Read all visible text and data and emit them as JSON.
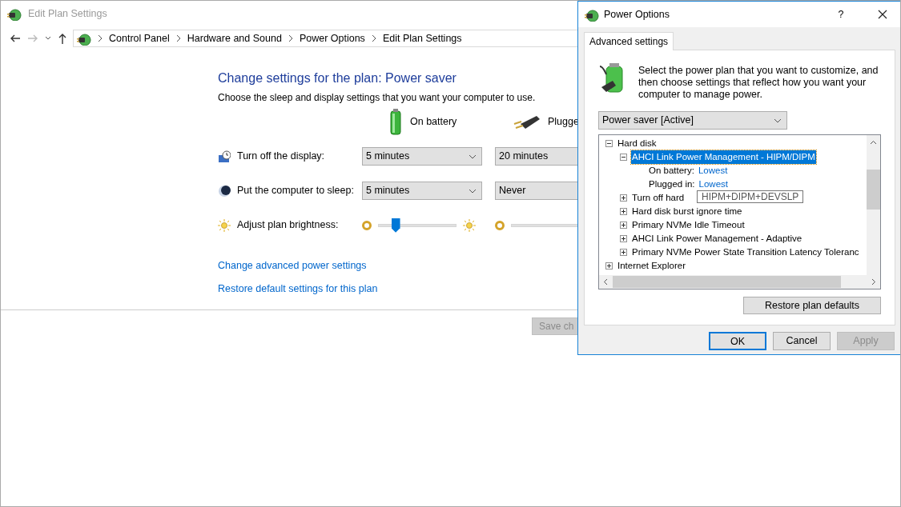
{
  "main_window": {
    "title": "Edit Plan Settings",
    "breadcrumb": [
      "Control Panel",
      "Hardware and Sound",
      "Power Options",
      "Edit Plan Settings"
    ],
    "heading": "Change settings for the plan: Power saver",
    "subheading": "Choose the sleep and display settings that you want your computer to use.",
    "columns": [
      {
        "label": "On battery",
        "kind": "battery"
      },
      {
        "label": "Plugge",
        "kind": "plug"
      }
    ],
    "settings": [
      {
        "label": "Turn off the display:",
        "kind": "display",
        "values": [
          "5 minutes",
          "20 minutes"
        ]
      },
      {
        "label": "Put the computer to sleep:",
        "kind": "sleep",
        "values": [
          "5 minutes",
          "Never"
        ]
      }
    ],
    "brightness": {
      "label": "Adjust plan brightness:",
      "level": 0.22
    },
    "links": [
      "Change advanced power settings",
      "Restore default settings for this plan"
    ],
    "save_button": {
      "label": "Save ch",
      "disabled": true
    }
  },
  "dialog": {
    "title": "Power Options",
    "help": "?",
    "tabs": [
      {
        "label": "Advanced settings",
        "selected": true
      }
    ],
    "intro": "Select the power plan that you want to customize, and then choose settings that reflect how you want your computer to manage power.",
    "plan": "Power saver [Active]",
    "tree": [
      {
        "label": "Hard disk",
        "expanded": true,
        "selected": false,
        "children": [
          {
            "label": "AHCI Link Power Management - HIPM/DIPM",
            "expanded": true,
            "selected": true,
            "settings": [
              {
                "label": "On battery:",
                "value": "Lowest"
              },
              {
                "label": "Plugged in:",
                "value": "Lowest"
              }
            ]
          },
          {
            "label": "Turn off hard",
            "expanded": false,
            "selected": false
          },
          {
            "label": "Hard disk burst ignore time",
            "expanded": false,
            "selected": false
          },
          {
            "label": "Primary NVMe Idle Timeout",
            "expanded": false,
            "selected": false
          },
          {
            "label": "AHCI Link Power Management - Adaptive",
            "expanded": false,
            "selected": false
          },
          {
            "label": "Primary NVMe Power State Transition Latency Toleranc",
            "expanded": false,
            "selected": false
          }
        ]
      },
      {
        "label": "Internet Explorer",
        "expanded": false,
        "selected": false
      }
    ],
    "tooltip": "HIPM+DIPM+DEVSLP",
    "restore_button": "Restore plan defaults",
    "buttons": [
      {
        "label": "OK",
        "default": true,
        "disabled": false
      },
      {
        "label": "Cancel",
        "default": false,
        "disabled": false
      },
      {
        "label": "Apply",
        "default": false,
        "disabled": true
      }
    ]
  }
}
